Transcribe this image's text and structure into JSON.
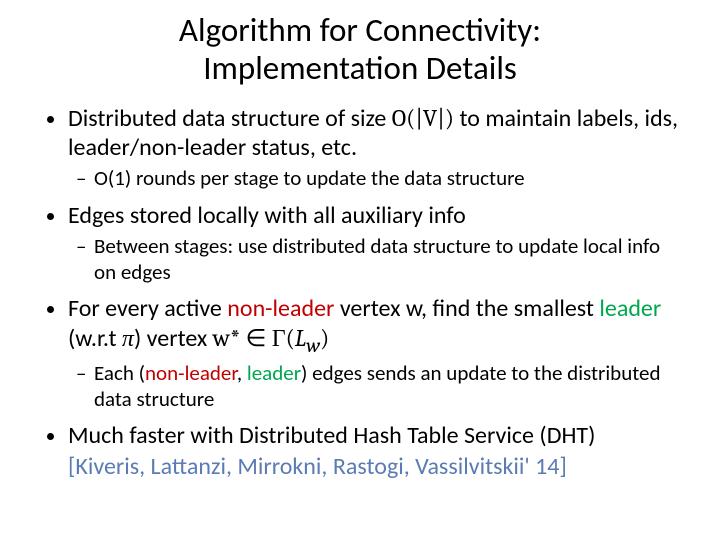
{
  "title_line1": "Algorithm for Connectivity:",
  "title_line2": "Implementation Details",
  "b1": {
    "pre": "Distributed data structure  of size ",
    "math": "O(|V|)",
    "post": " to maintain labels, ids, leader/non-leader status, etc.",
    "sub": "O(1) rounds per stage to update the data structure"
  },
  "b2": {
    "text": "Edges stored locally with all auxiliary info",
    "sub": "Between stages: use distributed data structure to update local info on edges"
  },
  "b3": {
    "t1": "For every ",
    "active": "active",
    "sp1": " ",
    "nonleader": "non-leader",
    "t2": " vertex w, find the smallest ",
    "leader": "leader",
    "t3": " (w.r.t ",
    "pi": "π",
    "t4": ") vertex ",
    "wstar": "w* ∈ Γ(",
    "lw_l": "L",
    "lw_w": "w",
    "close": ")",
    "sub_t1": "Each (",
    "sub_nl": "non-leader",
    "sub_comma": ", ",
    "sub_l": "leader",
    "sub_t2": ") edges sends an update to the distributed data structure"
  },
  "b4": {
    "text": "Much faster with Distributed Hash Table Service (DHT)",
    "cite": "[Kiveris, Lattanzi, Mirrokni, Rastogi, Vassilvitskii' 14]"
  }
}
